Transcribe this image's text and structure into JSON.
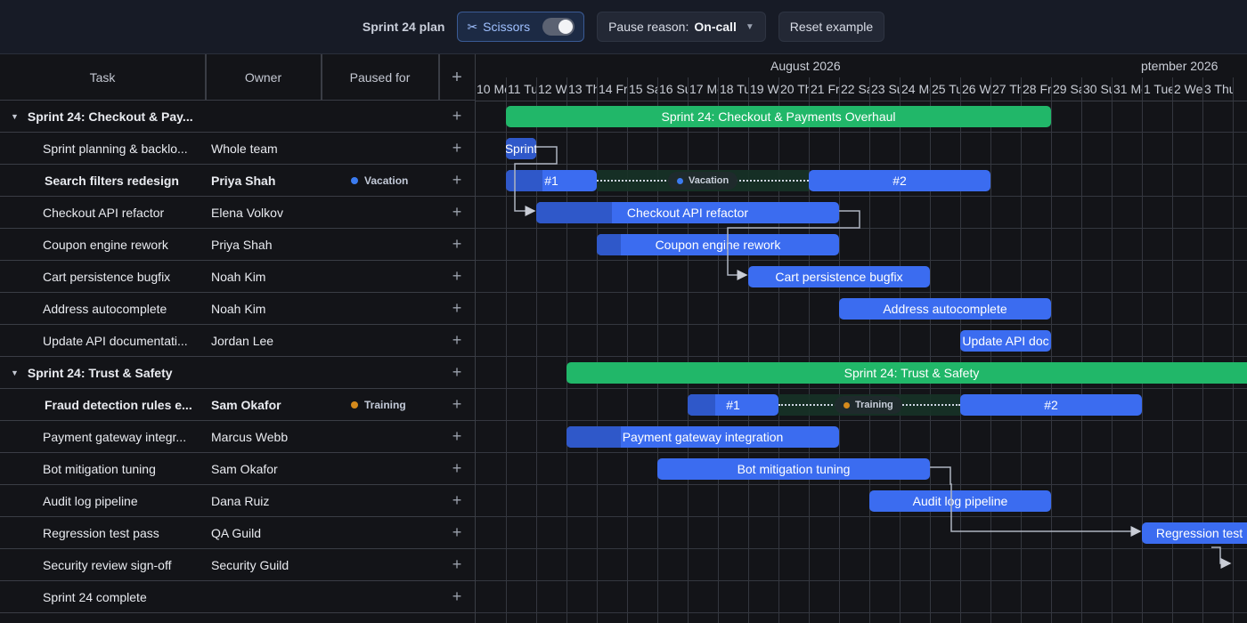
{
  "toolbar": {
    "title": "Sprint 24 plan",
    "scissors_label": "Scissors",
    "scissors_on": true,
    "pause_label": "Pause reason:",
    "pause_value": "On-call",
    "reset_label": "Reset example"
  },
  "columns": {
    "task": "Task",
    "owner": "Owner",
    "paused": "Paused for",
    "add": "+"
  },
  "timeline": {
    "months": [
      "August 2026",
      "ptember 2026"
    ],
    "days": [
      "10 Mo",
      "11 Tu",
      "12 We",
      "13 Th",
      "14 Fr",
      "15 Sa",
      "16 Su",
      "17 Mo",
      "18 Tu",
      "19 We",
      "20 Th",
      "21 Fr",
      "22 Sa",
      "23 Su",
      "24 Mo",
      "25 Tu",
      "26 We",
      "27 Th",
      "28 Fr",
      "29 Sa",
      "30 Su",
      "31 Mo",
      "1 Tue",
      "2 We",
      "3 Thu"
    ]
  },
  "rows": [
    {
      "task": "Sprint 24: Checkout & Pay...",
      "owner": "",
      "paused": "",
      "group": true
    },
    {
      "task": "Sprint planning & backlo...",
      "owner": "Whole team",
      "paused": ""
    },
    {
      "task": "Search filters redesign",
      "owner": "Priya Shah",
      "paused": "Vacation",
      "paused_color": "#3b7bf0",
      "bold": true
    },
    {
      "task": "Checkout API refactor",
      "owner": "Elena Volkov",
      "paused": ""
    },
    {
      "task": "Coupon engine rework",
      "owner": "Priya Shah",
      "paused": ""
    },
    {
      "task": "Cart persistence bugfix",
      "owner": "Noah Kim",
      "paused": ""
    },
    {
      "task": "Address autocomplete",
      "owner": "Noah Kim",
      "paused": ""
    },
    {
      "task": "Update API documentati...",
      "owner": "Jordan Lee",
      "paused": ""
    },
    {
      "task": "Sprint 24: Trust & Safety",
      "owner": "",
      "paused": "",
      "group": true
    },
    {
      "task": "Fraud detection rules e...",
      "owner": "Sam Okafor",
      "paused": "Training",
      "paused_color": "#d48a1c",
      "bold": true
    },
    {
      "task": "Payment gateway integr...",
      "owner": "Marcus Webb",
      "paused": ""
    },
    {
      "task": "Bot mitigation tuning",
      "owner": "Sam Okafor",
      "paused": ""
    },
    {
      "task": "Audit log pipeline",
      "owner": "Dana Ruiz",
      "paused": ""
    },
    {
      "task": "Regression test pass",
      "owner": "QA Guild",
      "paused": ""
    },
    {
      "task": "Security review sign-off",
      "owner": "Security Guild",
      "paused": ""
    },
    {
      "task": "Sprint 24 complete",
      "owner": "",
      "paused": ""
    }
  ],
  "bars": [
    {
      "row": 0,
      "start": 1,
      "end": 19,
      "label": "Sprint 24: Checkout & Payments Overhaul",
      "type": "summary"
    },
    {
      "row": 1,
      "start": 1,
      "end": 2,
      "label": "Sprint",
      "progress": 1.0
    },
    {
      "row": 2,
      "start": 1,
      "end": 4,
      "label": "#1",
      "progress": 0.4
    },
    {
      "row": 2,
      "start": 11,
      "end": 17,
      "label": "#2",
      "progress": 0
    },
    {
      "row": 3,
      "start": 2,
      "end": 12,
      "label": "Checkout API refactor",
      "progress": 0.25
    },
    {
      "row": 4,
      "start": 4,
      "end": 12,
      "label": "Coupon engine rework",
      "progress": 0.1
    },
    {
      "row": 5,
      "start": 9,
      "end": 15,
      "label": "Cart persistence bugfix",
      "progress": 0
    },
    {
      "row": 6,
      "start": 12,
      "end": 19,
      "label": "Address autocomplete",
      "progress": 0
    },
    {
      "row": 7,
      "start": 16,
      "end": 19,
      "label": "Update API doc",
      "progress": 0
    },
    {
      "row": 8,
      "start": 3,
      "end": 26,
      "label": "Sprint 24: Trust & Safety",
      "type": "summary"
    },
    {
      "row": 9,
      "start": 7,
      "end": 10,
      "label": "#1",
      "progress": 0.3
    },
    {
      "row": 9,
      "start": 16,
      "end": 22,
      "label": "#2",
      "progress": 0
    },
    {
      "row": 10,
      "start": 3,
      "end": 12,
      "label": "Payment gateway integration",
      "progress": 0.2
    },
    {
      "row": 11,
      "start": 6,
      "end": 15,
      "label": "Bot mitigation tuning",
      "progress": 0
    },
    {
      "row": 12,
      "start": 13,
      "end": 19,
      "label": "Audit log pipeline",
      "progress": 0
    },
    {
      "row": 13,
      "start": 22,
      "end": 26,
      "label": "Regression test",
      "progress": 0
    }
  ],
  "pauses": [
    {
      "row": 2,
      "start": 4,
      "end": 11,
      "label": "Vacation",
      "color": "#3b7bf0"
    },
    {
      "row": 9,
      "start": 10,
      "end": 16,
      "label": "Training",
      "color": "#d48a1c"
    }
  ]
}
